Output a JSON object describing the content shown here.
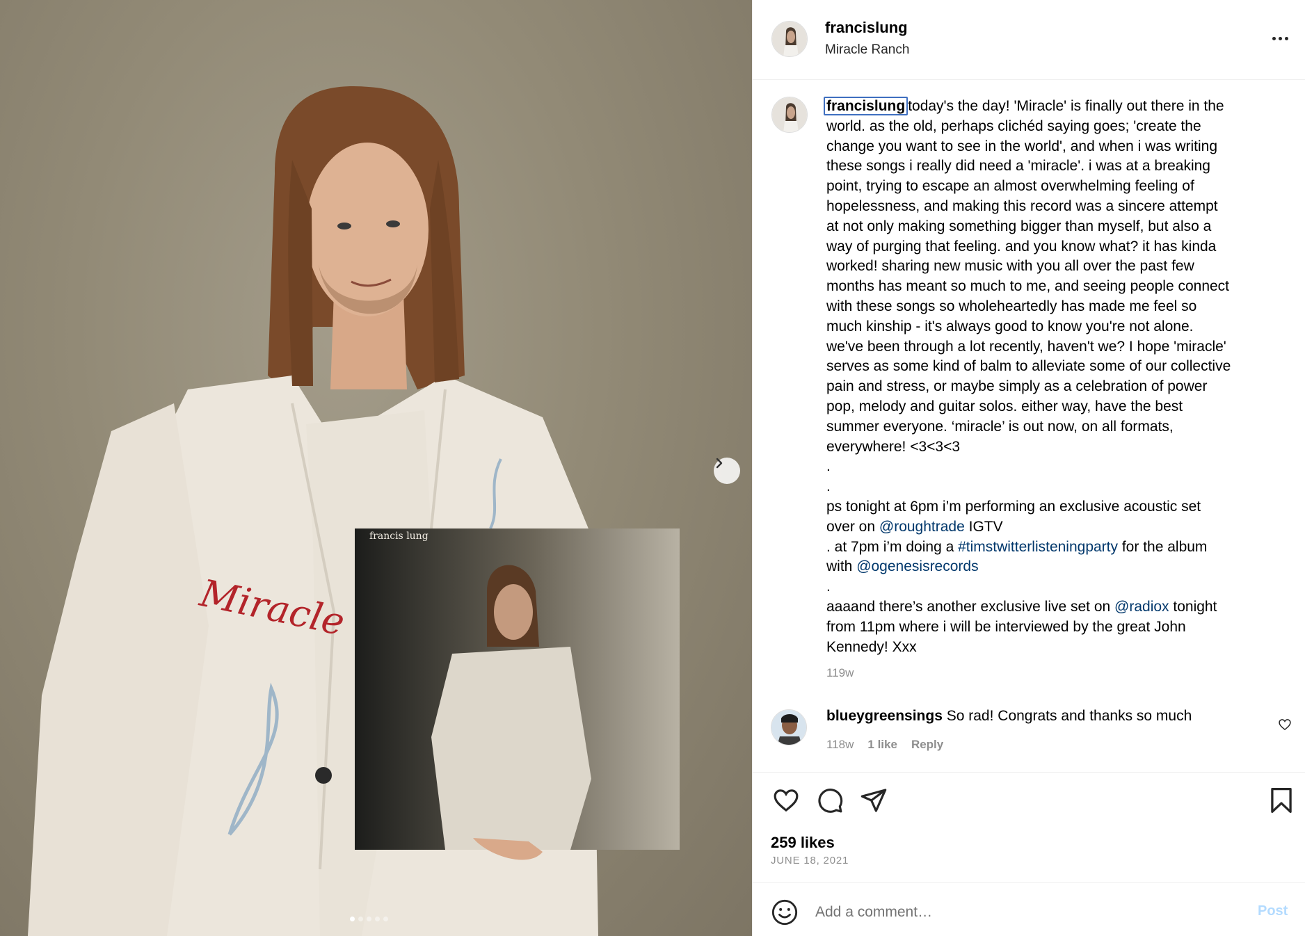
{
  "post": {
    "username": "francislung",
    "location": "Miracle Ranch",
    "record_brand": "francis lung",
    "caption_user": "francislung",
    "caption_lines": [
      [
        {
          "t": "today's the day! 'Miracle' is finally out there in the"
        }
      ],
      [
        {
          "t": "world. as the old, perhaps clichéd saying goes; 'create the"
        }
      ],
      [
        {
          "t": "change you want to see in the world', and when i was writing"
        }
      ],
      [
        {
          "t": "these songs i really did need a 'miracle'. i was at a breaking"
        }
      ],
      [
        {
          "t": "point, trying to escape an almost overwhelming feeling of"
        }
      ],
      [
        {
          "t": "hopelessness, and making this record was a sincere attempt"
        }
      ],
      [
        {
          "t": "at not only making something bigger than myself, but also a"
        }
      ],
      [
        {
          "t": "way of purging that feeling. and you know what? it has kinda"
        }
      ],
      [
        {
          "t": "worked! sharing new music with you all over the past few"
        }
      ],
      [
        {
          "t": "months has meant so much to me, and seeing people connect"
        }
      ],
      [
        {
          "t": "with these songs so wholeheartedly has made me feel so"
        }
      ],
      [
        {
          "t": "much kinship - it's always good to know you're not alone."
        }
      ],
      [
        {
          "t": "we've been through a lot recently, haven't we? I hope 'miracle'"
        }
      ],
      [
        {
          "t": "serves as some kind of balm to alleviate some of our collective"
        }
      ],
      [
        {
          "t": "pain and stress, or maybe simply as a celebration of power"
        }
      ],
      [
        {
          "t": "pop, melody and guitar solos. either way, have the best"
        }
      ],
      [
        {
          "t": "summer everyone. ‘miracle’ is out now, on all formats,"
        }
      ],
      [
        {
          "t": "everywhere! <3<3<3"
        }
      ],
      [
        {
          "t": "."
        }
      ],
      [
        {
          "t": "."
        }
      ],
      [
        {
          "t": "ps tonight at 6pm i’m performing an exclusive acoustic set"
        }
      ],
      [
        {
          "t": "over on "
        },
        {
          "t": "@roughtrade",
          "m": true
        },
        {
          "t": " IGTV"
        }
      ],
      [
        {
          "t": ". at 7pm i’m doing a "
        },
        {
          "t": "#timstwitterlisteningparty",
          "m": true
        },
        {
          "t": " for the album"
        }
      ],
      [
        {
          "t": "with "
        },
        {
          "t": "@ogenesisrecords",
          "m": true
        }
      ],
      [
        {
          "t": "."
        }
      ],
      [
        {
          "t": "aaaand there’s another exclusive live set on "
        },
        {
          "t": "@radiox",
          "m": true
        },
        {
          "t": " tonight"
        }
      ],
      [
        {
          "t": "from 11pm where i will be interviewed by the great John"
        }
      ],
      [
        {
          "t": "Kennedy! Xxx"
        }
      ]
    ],
    "caption_time": "119w",
    "likes": "259 likes",
    "date": "JUNE 18, 2021"
  },
  "comment": {
    "username": "blueygreensings",
    "text": "So rad! Congrats and thanks so much",
    "time": "118w",
    "likes": "1 like",
    "reply": "Reply"
  },
  "composer": {
    "placeholder": "Add a comment…",
    "post_label": "Post"
  },
  "carousel": {
    "count": 5,
    "active_index": 0
  },
  "icons": {
    "more": "more-options-icon",
    "next": "chevron-right-icon",
    "like": "heart-icon",
    "comment": "comment-bubble-icon",
    "share": "paper-plane-icon",
    "save": "bookmark-icon",
    "emoji": "emoji-smile-icon"
  },
  "colors": {
    "mention": "#00376b",
    "post_button": "#b3dbff",
    "secondary_text": "#8e8e8e",
    "focus_outline": "#3f6fc0"
  }
}
